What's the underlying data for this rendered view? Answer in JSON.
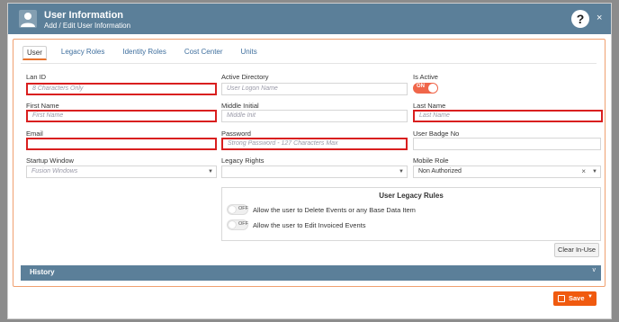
{
  "header": {
    "title": "User Information",
    "subtitle": "Add / Edit User Information"
  },
  "tabs": [
    {
      "label": "User"
    },
    {
      "label": "Legacy Roles"
    },
    {
      "label": "Identity Roles"
    },
    {
      "label": "Cost Center"
    },
    {
      "label": "Units"
    }
  ],
  "fields": {
    "lan_id": {
      "label": "Lan ID",
      "placeholder": "8 Characters Only"
    },
    "active_directory": {
      "label": "Active Directory",
      "placeholder": "User Logon Name"
    },
    "is_active": {
      "label": "Is Active",
      "toggle_text": "ON"
    },
    "first_name": {
      "label": "First Name",
      "placeholder": "First Name"
    },
    "middle_initial": {
      "label": "Middle Initial",
      "placeholder": "Middle Init"
    },
    "last_name": {
      "label": "Last Name",
      "placeholder": "Last Name"
    },
    "email": {
      "label": "Email",
      "placeholder": ""
    },
    "password": {
      "label": "Password",
      "placeholder": "Strong Password - 127 Characters Max"
    },
    "user_badge_no": {
      "label": "User Badge No",
      "placeholder": ""
    },
    "startup_window": {
      "label": "Startup Window",
      "value": "Fusion Windows"
    },
    "legacy_rights": {
      "label": "Legacy Rights",
      "value": ""
    },
    "mobile_role": {
      "label": "Mobile Role",
      "value": "Non Authorized"
    }
  },
  "legacy_rules": {
    "title": "User Legacy Rules",
    "toggle_text": "OFF",
    "rules": [
      {
        "text": "Allow the user to Delete Events or any Base Data Item"
      },
      {
        "text": "Allow the user to Edit Invoiced Events"
      }
    ]
  },
  "buttons": {
    "clear_in_use": "Clear In-Use",
    "save": "Save"
  },
  "history": {
    "label": "History"
  },
  "icons": {
    "help": "?",
    "close": "×",
    "caret": "▼",
    "clear": "×",
    "chevron": "v"
  },
  "colors": {
    "header": "#5b7f99",
    "accent": "#f05a0f",
    "required_border": "#d91f1f",
    "toggle_on": "#f0664a"
  }
}
